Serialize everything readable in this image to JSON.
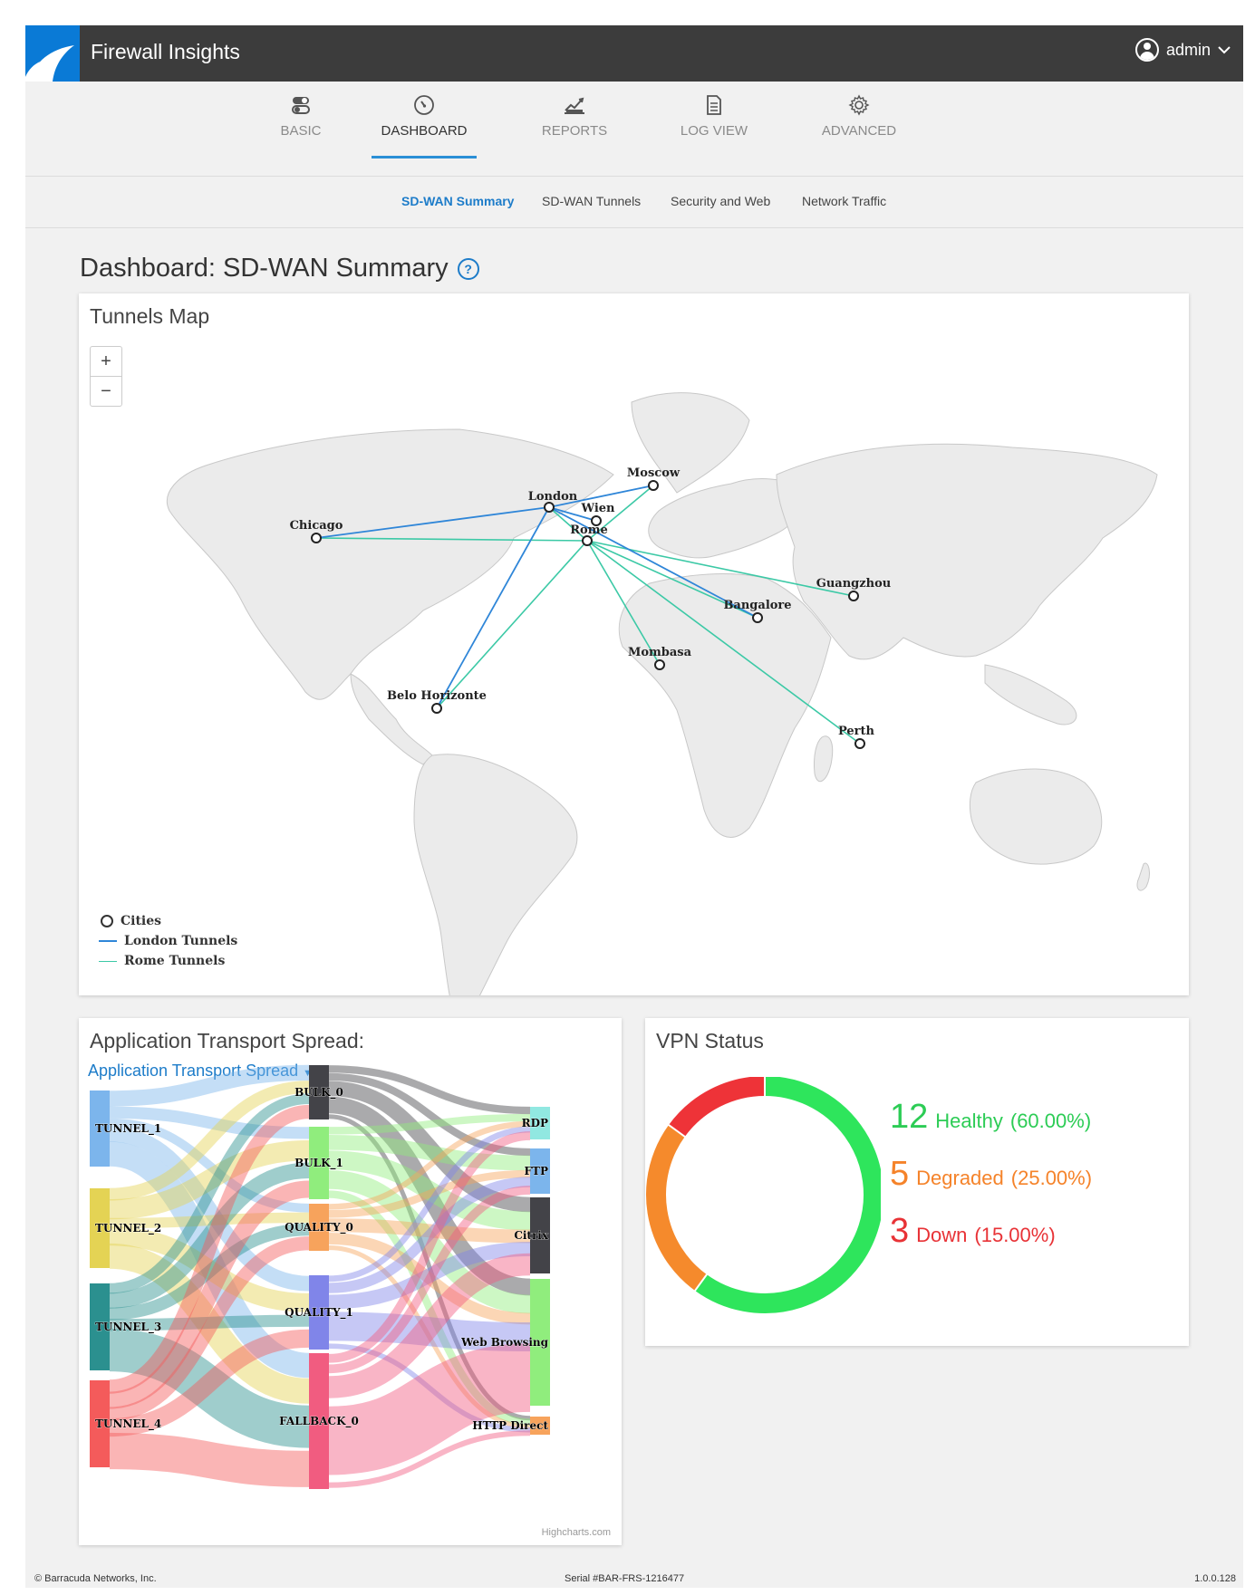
{
  "app": {
    "title": "Firewall Insights",
    "user": "admin"
  },
  "main_nav": [
    {
      "label": "BASIC",
      "icon": "toggles-icon"
    },
    {
      "label": "DASHBOARD",
      "icon": "speedometer-icon"
    },
    {
      "label": "REPORTS",
      "icon": "chart-icon"
    },
    {
      "label": "LOG VIEW",
      "icon": "document-icon"
    },
    {
      "label": "ADVANCED",
      "icon": "gear-icon"
    }
  ],
  "active_main_nav": "DASHBOARD",
  "sub_nav": [
    {
      "label": "SD-WAN Summary"
    },
    {
      "label": "SD-WAN Tunnels"
    },
    {
      "label": "Security and Web"
    },
    {
      "label": "Network Traffic"
    }
  ],
  "active_sub_nav": "SD-WAN Summary",
  "page": {
    "title": "Dashboard: SD-WAN Summary",
    "help": "?"
  },
  "tunnels_map": {
    "title": "Tunnels Map",
    "zoom_in": "+",
    "zoom_out": "−",
    "cities": [
      "Moscow",
      "London",
      "Wien",
      "Rome",
      "Chicago",
      "Guangzhou",
      "Bangalore",
      "Mombasa",
      "Belo Horizonte",
      "Perth"
    ],
    "london_tunnels": [
      "Chicago",
      "Moscow",
      "Wien",
      "Bangalore",
      "Belo Horizonte"
    ],
    "rome_tunnels": [
      "Chicago",
      "London",
      "Moscow",
      "Guangzhou",
      "Bangalore",
      "Mombasa",
      "Perth",
      "Belo Horizonte"
    ],
    "legend": {
      "cities": "Cities",
      "london": "London Tunnels",
      "rome": "Rome Tunnels"
    },
    "colors": {
      "london": "#2f86d8",
      "rome": "#3cc9a6",
      "land": "#ebebeb"
    }
  },
  "transport": {
    "title": "Application Transport Spread:",
    "dropdown": "Application Transport Spread",
    "credit": "Highcharts.com",
    "chart_data": {
      "type": "sankey",
      "nodes": {
        "tunnels": [
          "TUNNEL_1",
          "TUNNEL_2",
          "TUNNEL_3",
          "TUNNEL_4"
        ],
        "classes": [
          "BULK_0",
          "BULK_1",
          "QUALITY_0",
          "QUALITY_1",
          "FALLBACK_0"
        ],
        "apps": [
          "RDP",
          "FTP",
          "Citrix",
          "Web Browsing",
          "HTTP Direct"
        ]
      },
      "colors": {
        "TUNNEL_1": "#7cb5ec",
        "TUNNEL_2": "#e4d354",
        "TUNNEL_3": "#2b908f",
        "TUNNEL_4": "#f45b5b",
        "BULK_0": "#434348",
        "BULK_1": "#90ed7d",
        "QUALITY_0": "#f7a35c",
        "QUALITY_1": "#8085e9",
        "FALLBACK_0": "#f15c80",
        "RDP": "#91e8e1",
        "FTP": "#7cb5ec",
        "Citrix": "#434348",
        "Web Browsing": "#90ed7d",
        "HTTP Direct": "#f7a35c"
      }
    }
  },
  "vpn": {
    "title": "VPN Status",
    "chart_data": {
      "type": "pie",
      "donut": true,
      "slices": [
        {
          "label": "Healthy",
          "value": 12,
          "percent": "(60.00%)",
          "color": "#2ee55c"
        },
        {
          "label": "Degraded",
          "value": 5,
          "percent": "(25.00%)",
          "color": "#f58a2c"
        },
        {
          "label": "Down",
          "value": 3,
          "percent": "(15.00%)",
          "color": "#ee3338"
        }
      ]
    }
  },
  "footer": {
    "left": "© Barracuda Networks, Inc.",
    "center": "Serial #BAR-FRS-1216477",
    "right": "1.0.0.128"
  }
}
